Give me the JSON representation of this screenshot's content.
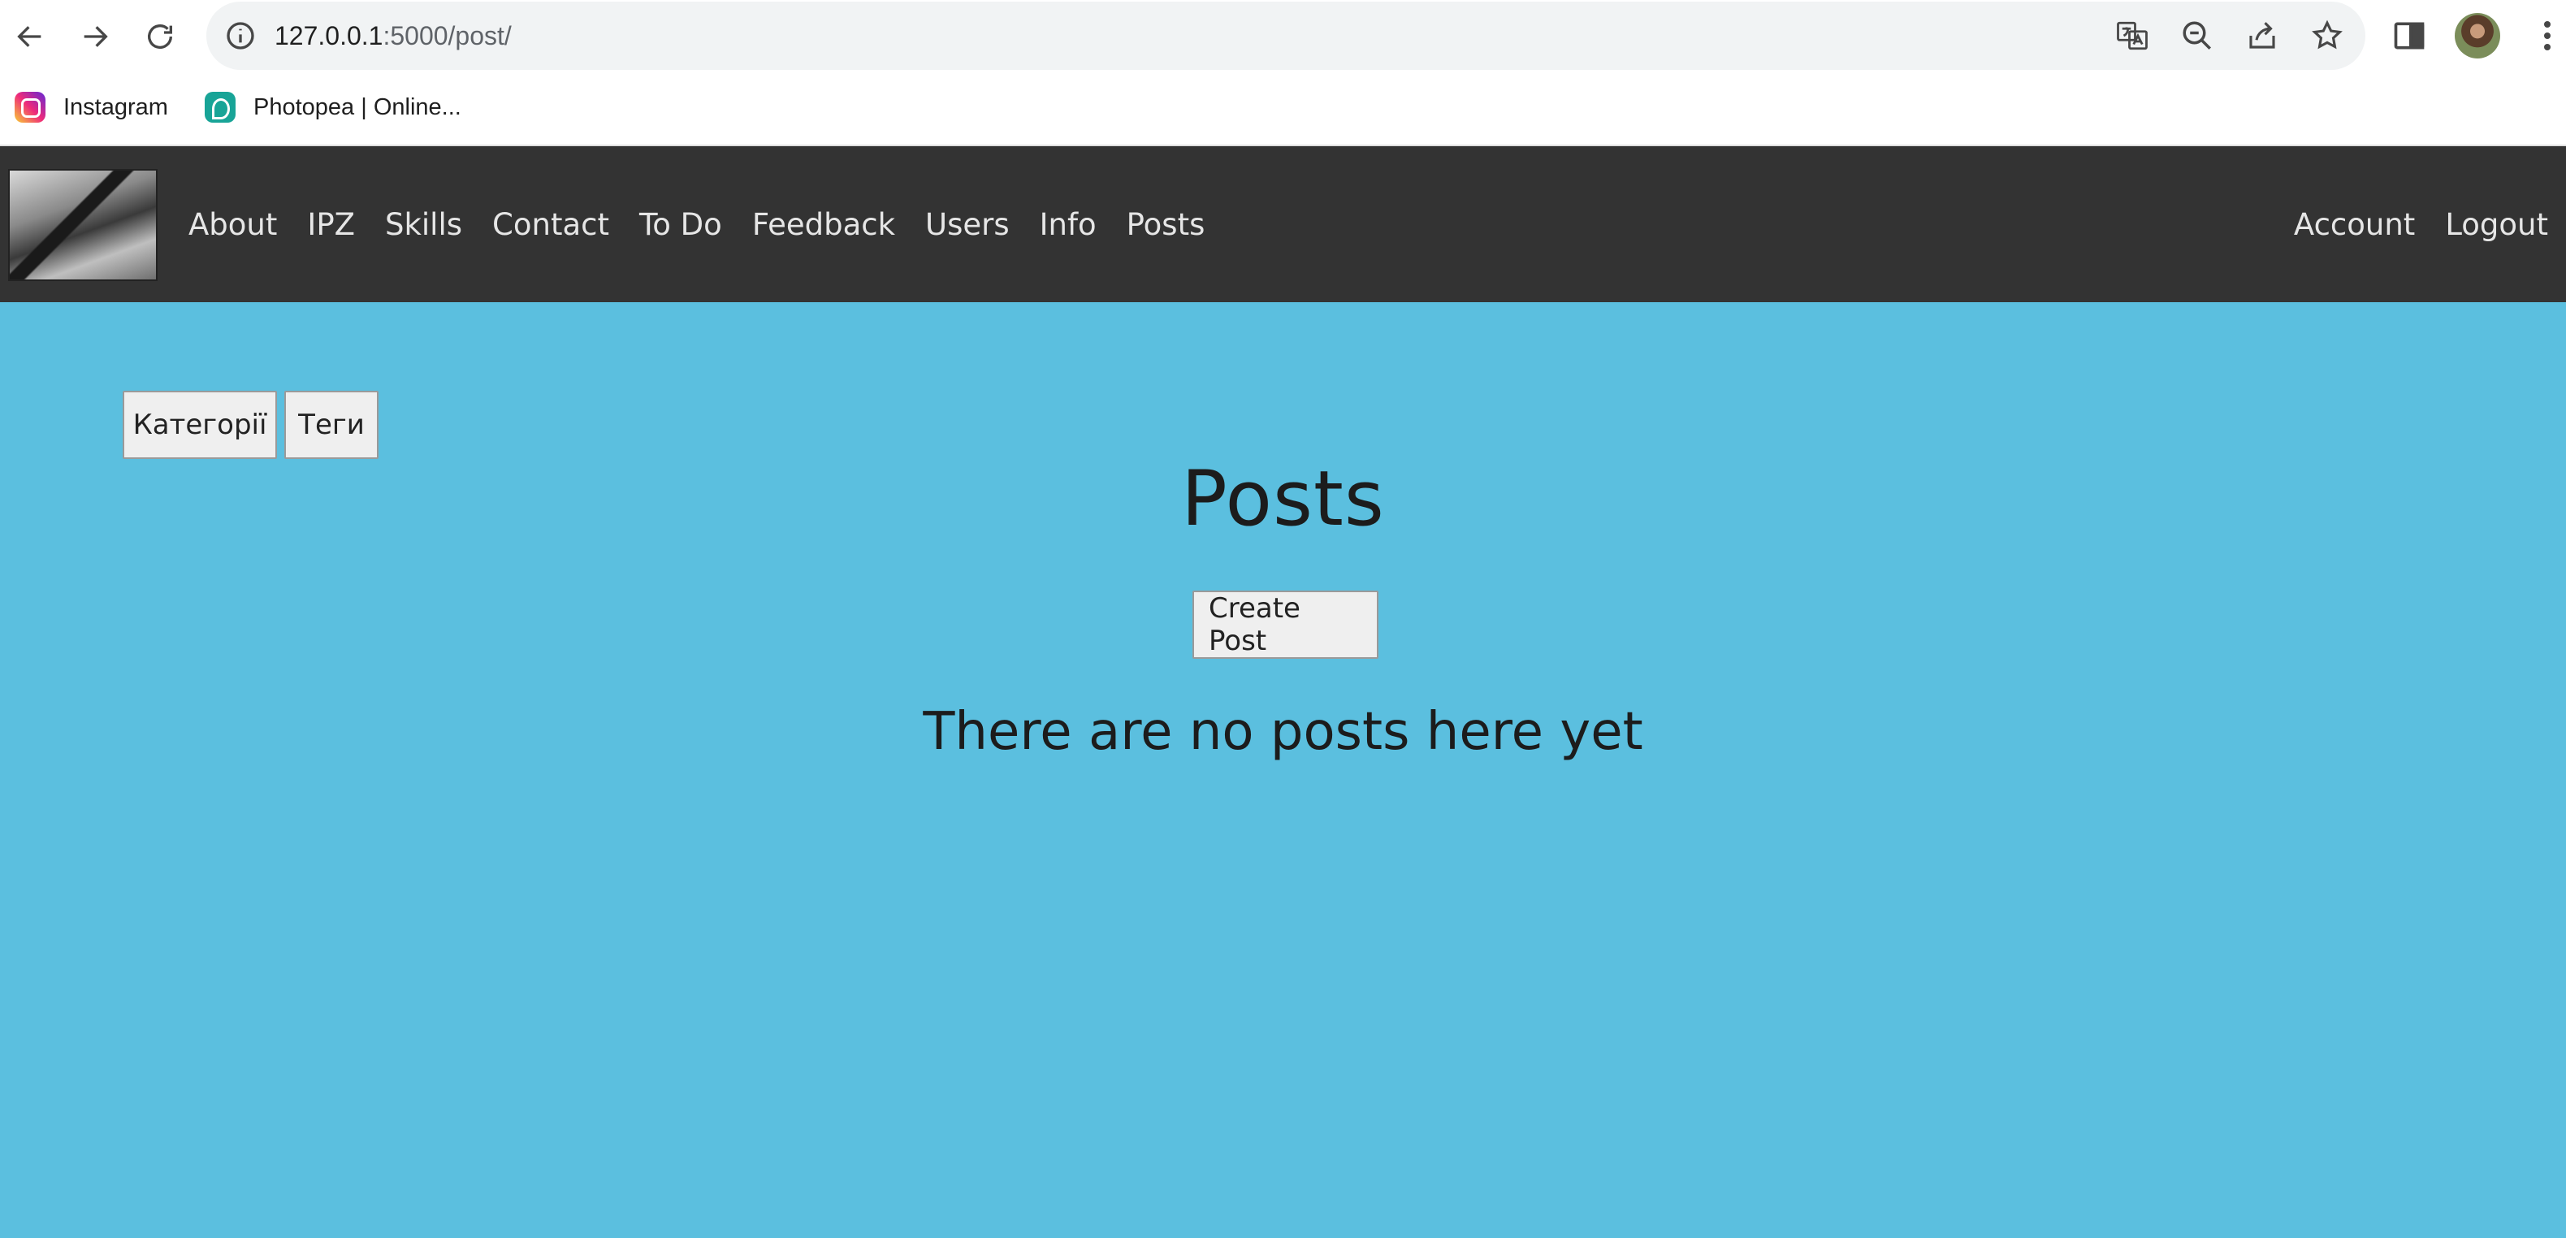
{
  "browser": {
    "url_host": "127.0.0.1",
    "url_path": ":5000/post/",
    "bookmarks": [
      {
        "label": "Instagram",
        "icon": "instagram-icon"
      },
      {
        "label": "Photopea | Online...",
        "icon": "photopea-icon"
      }
    ]
  },
  "navbar": {
    "links": [
      "About",
      "IPZ",
      "Skills",
      "Contact",
      "To Do",
      "Feedback",
      "Users",
      "Info",
      "Posts"
    ],
    "right_links": [
      "Account",
      "Logout"
    ]
  },
  "content": {
    "category_button": "Категорії",
    "tags_button": "Теги",
    "title": "Posts",
    "create_button": "Create Post",
    "empty_message": "There are no posts here yet"
  },
  "colors": {
    "page_background": "#5bbfdf",
    "navbar_background": "#333333",
    "navbar_text": "#e6e6e6"
  }
}
